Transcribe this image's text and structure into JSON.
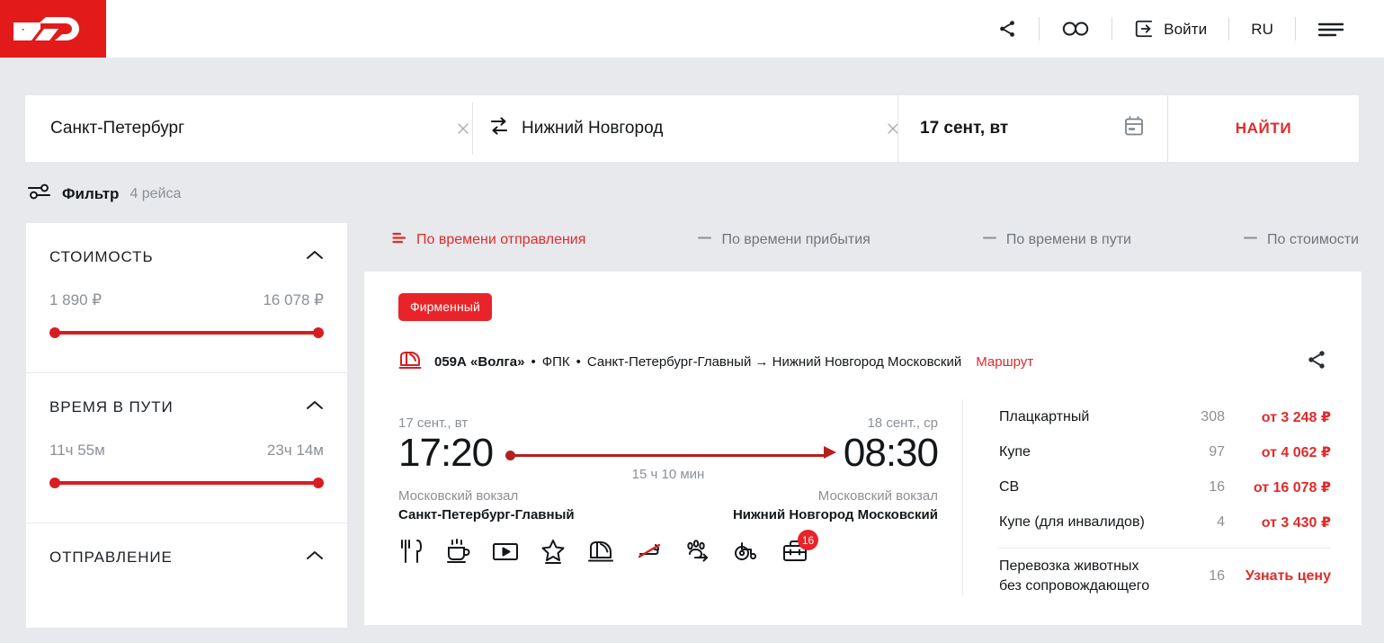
{
  "header": {
    "logo_alt": "РЖД",
    "share_icon": "share-icon",
    "accessibility_icon": "glasses-icon",
    "login_icon": "login-arrow-icon",
    "login_label": "Войти",
    "lang_label": "RU",
    "menu_icon": "hamburger-menu-icon"
  },
  "search": {
    "from": "Санкт-Петербург",
    "to": "Нижний Новгород",
    "date": "17 сент, вт",
    "swap_icon": "swap-arrows-icon",
    "calendar_icon": "calendar-icon",
    "clear_icon": "close-icon",
    "find_label": "НАЙТИ"
  },
  "filter_header": {
    "icon": "filter-sliders-icon",
    "label": "Фильтр",
    "count": "4 рейса"
  },
  "filters": [
    {
      "title": "СТОИМОСТЬ",
      "min": "1 890 ₽",
      "max": "16 078 ₽",
      "has_slider": true
    },
    {
      "title": "ВРЕМЯ В ПУТИ",
      "min": "11ч 55м",
      "max": "23ч 14м",
      "has_slider": true
    },
    {
      "title": "ОТПРАВЛЕНИЕ",
      "has_slider": false
    }
  ],
  "sort_tabs": [
    {
      "label": "По времени отправления",
      "active": true
    },
    {
      "label": "По времени прибытия",
      "active": false
    },
    {
      "label": "По времени в пути",
      "active": false
    },
    {
      "label": "По стоимости",
      "active": false
    }
  ],
  "train": {
    "badge": "Фирменный",
    "train_icon": "train-icon",
    "number": "059А «Волга»",
    "sep1": "•",
    "carrier": "ФПК",
    "sep2": "•",
    "route": "Санкт-Петербург-Главный → Нижний Новгород Московский",
    "route_link": "Маршрут",
    "share_icon": "share-icon",
    "departure": {
      "date": "17 сент., вт",
      "time": "17:20",
      "station_sub": "Московский вокзал",
      "station": "Санкт-Петербург-Главный"
    },
    "arrival": {
      "date": "18 сент., ср",
      "time": "08:30",
      "station_sub": "Московский вокзал",
      "station": "Нижний Новгород Московский"
    },
    "duration": "15 ч 10 мин",
    "amenities": [
      {
        "icon": "restaurant-icon",
        "badge": ""
      },
      {
        "icon": "hot-drinks-icon",
        "badge": ""
      },
      {
        "icon": "video-icon",
        "badge": ""
      },
      {
        "icon": "star-icon",
        "badge": ""
      },
      {
        "icon": "train-icon",
        "badge": ""
      },
      {
        "icon": "no-smoking-icon",
        "badge": ""
      },
      {
        "icon": "pets-icon",
        "badge": ""
      },
      {
        "icon": "wheelchair-icon",
        "badge": ""
      },
      {
        "icon": "luggage-icon",
        "badge": "16"
      }
    ],
    "prices": [
      {
        "name": "Плацкартный",
        "seats": "308",
        "price": "от 3 248 ₽",
        "is_link": false
      },
      {
        "name": "Купе",
        "seats": "97",
        "price": "от 4 062 ₽",
        "is_link": false
      },
      {
        "name": "СВ",
        "seats": "16",
        "price": "от 16 078 ₽",
        "is_link": false
      },
      {
        "name": "Купе (для инвалидов)",
        "seats": "4",
        "price": "от 3 430 ₽",
        "is_link": false
      }
    ],
    "extra_row": {
      "name_line1": "Перевозка животных",
      "name_line2": "без сопровождающего",
      "seats": "16",
      "price": "Узнать цену"
    }
  },
  "colors": {
    "brand_red": "#e21a1a",
    "accent_red": "#e02b2b",
    "slider_red": "#d81d21",
    "page_bg": "#e7e9ec",
    "text_dark": "#13171a",
    "text_muted": "#8b9096"
  }
}
